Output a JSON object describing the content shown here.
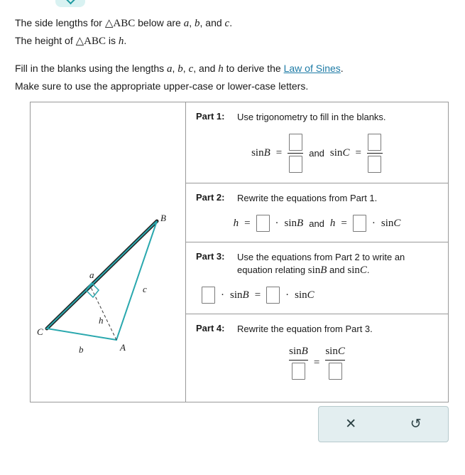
{
  "top_notch": {
    "icon": "chevron-down-icon"
  },
  "intro": {
    "line1_a": "The side lengths for ",
    "line1_tri": "△ABC",
    "line1_b": " below are ",
    "line1_a_var": "a",
    "line1_comma1": ", ",
    "line1_b_var": "b",
    "line1_comma2": ", and ",
    "line1_c_var": "c",
    "line1_end": ".",
    "line2_a": "The height of ",
    "line2_tri": "△ABC",
    "line2_b": " is ",
    "line2_h": "h",
    "line2_end": ".",
    "line3_a": "Fill in the blanks using the lengths ",
    "line3_a_var": "a",
    "line3_sep1": ", ",
    "line3_b_var": "b",
    "line3_sep2": ", ",
    "line3_c_var": "c",
    "line3_sep3": ", and ",
    "line3_h_var": "h",
    "line3_b": " to derive the ",
    "line3_link": "Law of Sines",
    "line3_end": ".",
    "line4": "Make sure to use the appropriate upper-case or lower-case letters."
  },
  "figure": {
    "vertex_A": "A",
    "vertex_B": "B",
    "vertex_C": "C",
    "side_a": "a",
    "side_b": "b",
    "side_c": "c",
    "height_h": "h"
  },
  "parts": [
    {
      "label": "Part 1:",
      "text": "Use trigonometry to fill in the blanks.",
      "equation": {
        "lhs_fn": "sin",
        "lhs_arg": "B",
        "eq": "=",
        "conj": "and",
        "rhs_fn": "sin",
        "rhs_arg": "C"
      }
    },
    {
      "label": "Part 2:",
      "text": "Rewrite the equations from Part 1.",
      "equation": {
        "h1": "h",
        "eq1": "=",
        "dot1": "·",
        "fn1": "sin",
        "arg1": "B",
        "conj": "and",
        "h2": "h",
        "eq2": "=",
        "dot2": "·",
        "fn2": "sin",
        "arg2": "C"
      }
    },
    {
      "label": "Part 3:",
      "text_line1": "Use the equations from Part 2 to write an",
      "text_line2_a": "equation relating ",
      "text_line2_fn1": "sin",
      "text_line2_arg1": "B",
      "text_line2_mid": " and ",
      "text_line2_fn2": "sin",
      "text_line2_arg2": "C",
      "text_line2_end": ".",
      "equation": {
        "dot1": "·",
        "fn1": "sin",
        "arg1": "B",
        "eq": "=",
        "dot2": "·",
        "fn2": "sin",
        "arg2": "C"
      }
    },
    {
      "label": "Part 4:",
      "text": "Rewrite the equation from Part 3.",
      "equation": {
        "num1_fn": "sin",
        "num1_arg": "B",
        "eq": "=",
        "num2_fn": "sin",
        "num2_arg": "C"
      }
    }
  ],
  "toolbar": {
    "clear_icon": "close-icon",
    "clear_glyph": "✕",
    "undo_icon": "undo-icon",
    "undo_glyph": "↺"
  },
  "colors": {
    "triangle": "#2aa8ae",
    "link": "#1e7ba6",
    "toolbar_bg": "#e3eef0",
    "notch_bg": "#d9f2f2"
  }
}
